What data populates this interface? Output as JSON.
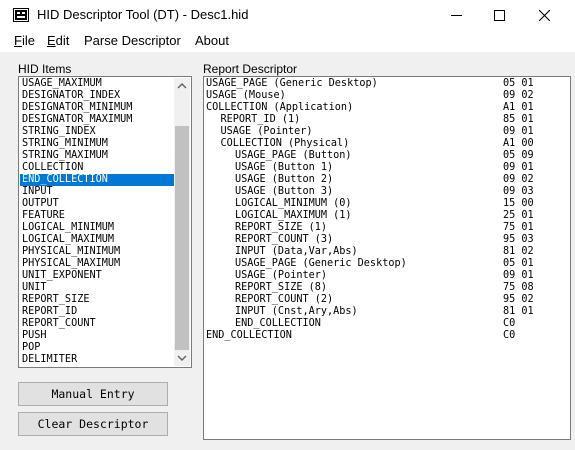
{
  "window": {
    "title": "HID Descriptor Tool (DT) - Desc1.hid",
    "controls": {
      "minimize": "—",
      "maximize": "☐",
      "close": "✕"
    }
  },
  "menu": [
    {
      "label": "File",
      "mnemonic": "F",
      "rest": "ile"
    },
    {
      "label": "Edit",
      "mnemonic": "E",
      "rest": "dit"
    },
    {
      "label": "Parse Descriptor",
      "mnemonic": "",
      "rest": "Parse Descriptor"
    },
    {
      "label": "About",
      "mnemonic": "",
      "rest": "About"
    }
  ],
  "hid_items": {
    "label": "HID Items",
    "items": [
      "USAGE_MAXIMUM",
      "DESIGNATOR_INDEX",
      "DESIGNATOR_MINIMUM",
      "DESIGNATOR_MAXIMUM",
      "STRING_INDEX",
      "STRING_MINIMUM",
      "STRING_MAXIMUM",
      "COLLECTION",
      "END_COLLECTION",
      "INPUT",
      "OUTPUT",
      "FEATURE",
      "LOGICAL_MINIMUM",
      "LOGICAL_MAXIMUM",
      "PHYSICAL_MINIMUM",
      "PHYSICAL_MAXIMUM",
      "UNIT_EXPONENT",
      "UNIT",
      "REPORT_SIZE",
      "REPORT_ID",
      "REPORT_COUNT",
      "PUSH",
      "POP",
      "DELIMITER"
    ],
    "selected": "END_COLLECTION"
  },
  "buttons": {
    "manual_entry": "Manual Entry",
    "clear_descriptor": "Clear Descriptor"
  },
  "report": {
    "label": "Report Descriptor",
    "lines": [
      {
        "indent": 0,
        "text": "USAGE_PAGE (Generic Desktop)",
        "bytes": "05 01"
      },
      {
        "indent": 0,
        "text": "USAGE (Mouse)",
        "bytes": "09 02"
      },
      {
        "indent": 0,
        "text": "COLLECTION (Application)",
        "bytes": "A1 01"
      },
      {
        "indent": 1,
        "text": "REPORT_ID (1)",
        "bytes": "85 01"
      },
      {
        "indent": 1,
        "text": "USAGE (Pointer)",
        "bytes": "09 01"
      },
      {
        "indent": 1,
        "text": "COLLECTION (Physical)",
        "bytes": "A1 00"
      },
      {
        "indent": 2,
        "text": "USAGE_PAGE (Button)",
        "bytes": "05 09"
      },
      {
        "indent": 2,
        "text": "USAGE (Button 1)",
        "bytes": "09 01"
      },
      {
        "indent": 2,
        "text": "USAGE (Button 2)",
        "bytes": "09 02"
      },
      {
        "indent": 2,
        "text": "USAGE (Button 3)",
        "bytes": "09 03"
      },
      {
        "indent": 2,
        "text": "LOGICAL_MINIMUM (0)",
        "bytes": "15 00"
      },
      {
        "indent": 2,
        "text": "LOGICAL_MAXIMUM (1)",
        "bytes": "25 01"
      },
      {
        "indent": 2,
        "text": "REPORT_SIZE (1)",
        "bytes": "75 01"
      },
      {
        "indent": 2,
        "text": "REPORT_COUNT (3)",
        "bytes": "95 03"
      },
      {
        "indent": 2,
        "text": "INPUT (Data,Var,Abs)",
        "bytes": "81 02"
      },
      {
        "indent": 2,
        "text": "USAGE_PAGE (Generic Desktop)",
        "bytes": "05 01"
      },
      {
        "indent": 2,
        "text": "USAGE (Pointer)",
        "bytes": "09 01"
      },
      {
        "indent": 2,
        "text": "REPORT_SIZE (8)",
        "bytes": "75 08"
      },
      {
        "indent": 2,
        "text": "REPORT_COUNT (2)",
        "bytes": "95 02"
      },
      {
        "indent": 2,
        "text": "INPUT (Cnst,Ary,Abs)",
        "bytes": "81 01"
      },
      {
        "indent": 2,
        "text": "END_COLLECTION",
        "bytes": "C0"
      },
      {
        "indent": 0,
        "text": "END_COLLECTION",
        "bytes": "C0"
      }
    ]
  },
  "colors": {
    "selection": "#0078d7",
    "window_bg": "#f0f0f0",
    "button_bg": "#e1e1e1"
  },
  "icons": {
    "app": "app-icon",
    "scroll_up": "chevron-up-icon",
    "scroll_down": "chevron-down-icon"
  }
}
